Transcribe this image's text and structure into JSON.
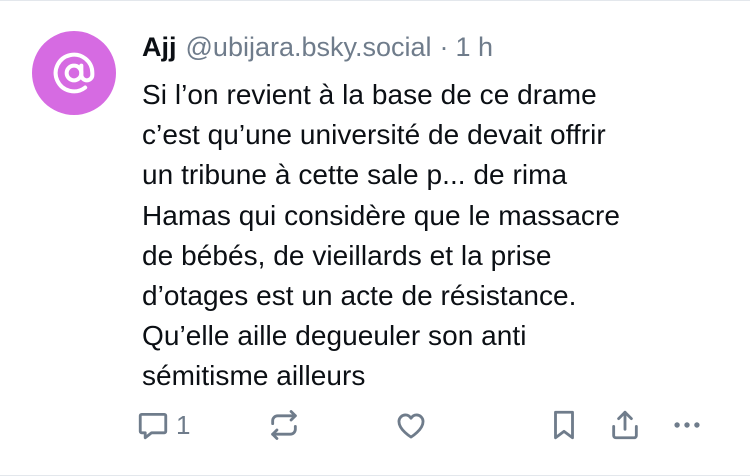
{
  "post": {
    "author": {
      "display_name": "Ajj",
      "handle": "@ubijara.bsky.social",
      "avatar_icon": "at-sign-icon",
      "avatar_color": "#d66be2"
    },
    "separator": "·",
    "time": "1 h",
    "text": "Si l’on revient à la base de ce drame\nc’est qu’une université de devait offrir\nun tribune à cette sale p... de rima\nHamas qui considère que le massacre\nde bébés, de vieillards et la prise\nd’otages est un acte de résistance.\nQu’elle aille degueuler son anti\nsémitisme ailleurs",
    "actions": {
      "reply_icon": "reply-icon",
      "reply_count": "1",
      "repost_icon": "repost-icon",
      "like_icon": "heart-icon",
      "bookmark_icon": "bookmark-icon",
      "share_icon": "share-icon",
      "more_icon": "more-options-icon"
    }
  },
  "colors": {
    "text": "#0b0f14",
    "muted": "#6f7c8b",
    "icon": "#6f7c8b",
    "divider": "#e3e7ec",
    "avatar": "#d66be2"
  }
}
